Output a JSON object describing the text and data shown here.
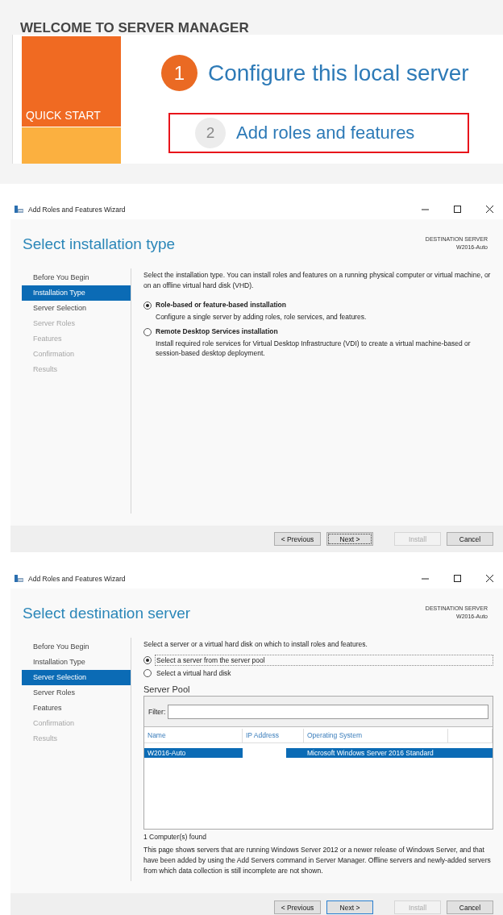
{
  "server_manager": {
    "title": "WELCOME TO SERVER MANAGER",
    "tile": {
      "label": "QUICK START"
    },
    "steps": [
      {
        "number": "1",
        "label": "Configure this local server",
        "active": true,
        "highlighted": false
      },
      {
        "number": "2",
        "label": "Add roles and features",
        "active": false,
        "highlighted": true
      }
    ]
  },
  "wizards": [
    {
      "window_title": "Add Roles and Features Wizard",
      "heading": "Select installation type",
      "destination_label": "DESTINATION SERVER",
      "destination_value": "W2016-Auto",
      "steps": [
        {
          "label": "Before You Begin",
          "selected": false,
          "disabled": false
        },
        {
          "label": "Installation Type",
          "selected": true,
          "disabled": false
        },
        {
          "label": "Server Selection",
          "selected": false,
          "disabled": false
        },
        {
          "label": "Server Roles",
          "selected": false,
          "disabled": true
        },
        {
          "label": "Features",
          "selected": false,
          "disabled": true
        },
        {
          "label": "Confirmation",
          "selected": false,
          "disabled": true
        },
        {
          "label": "Results",
          "selected": false,
          "disabled": true
        }
      ],
      "content": [
        {
          "kind": "paragraph",
          "text": "Select the installation type. You can install roles and features on a running physical computer or virtual machine, or on an offline virtual hard disk (VHD)."
        },
        {
          "kind": "option",
          "label": "Role-based or feature-based installation",
          "description": "Configure a single server by adding roles, role services, and features.",
          "selected": true,
          "focused": false
        },
        {
          "kind": "option",
          "label": "Remote Desktop Services installation",
          "description": "Install required role services for Virtual Desktop Infrastructure (VDI) to create a virtual machine-based or session-based desktop deployment.",
          "selected": false,
          "focused": false
        }
      ],
      "buttons": [
        {
          "label": "< Previous",
          "disabled": false,
          "focused": false,
          "default": false
        },
        {
          "label": "Next >",
          "disabled": false,
          "focused": true,
          "default": false
        },
        {
          "label": "Install",
          "disabled": true,
          "focused": false,
          "default": false
        },
        {
          "label": "Cancel",
          "disabled": false,
          "focused": false,
          "default": false
        }
      ]
    },
    {
      "window_title": "Add Roles and Features Wizard",
      "heading": "Select destination server",
      "destination_label": "DESTINATION SERVER",
      "destination_value": "W2016-Auto",
      "steps": [
        {
          "label": "Before You Begin",
          "selected": false,
          "disabled": false
        },
        {
          "label": "Installation Type",
          "selected": false,
          "disabled": false
        },
        {
          "label": "Server Selection",
          "selected": true,
          "disabled": false
        },
        {
          "label": "Server Roles",
          "selected": false,
          "disabled": false
        },
        {
          "label": "Features",
          "selected": false,
          "disabled": false
        },
        {
          "label": "Confirmation",
          "selected": false,
          "disabled": true
        },
        {
          "label": "Results",
          "selected": false,
          "disabled": true
        }
      ],
      "content": [
        {
          "kind": "paragraph",
          "text": "Select a server or a virtual hard disk on which to install roles and features."
        },
        {
          "kind": "radio",
          "label": "Select a server from the server pool",
          "selected": true,
          "focused": true
        },
        {
          "kind": "radio",
          "label": "Select a virtual hard disk",
          "selected": false,
          "focused": false
        },
        {
          "kind": "server_pool",
          "title": "Server Pool",
          "filter_label": "Filter:",
          "columns": [
            "Name",
            "IP Address",
            "Operating System"
          ],
          "rows": [
            {
              "name": "W2016-Auto",
              "operating_system": "Microsoft Windows Server 2016 Standard",
              "selected": true
            }
          ]
        },
        {
          "kind": "count",
          "text": "1 Computer(s) found"
        },
        {
          "kind": "paragraph",
          "text": "This page shows servers that are running Windows Server 2012 or a newer release of Windows Server, and that have been added by using the Add Servers command in Server Manager. Offline servers and newly-added servers from which data collection is still incomplete are not shown."
        }
      ],
      "buttons": [
        {
          "label": "< Previous",
          "disabled": false,
          "focused": false,
          "default": false
        },
        {
          "label": "Next >",
          "disabled": false,
          "focused": false,
          "default": true
        },
        {
          "label": "Install",
          "disabled": true,
          "focused": false,
          "default": false
        },
        {
          "label": "Cancel",
          "disabled": false,
          "focused": false,
          "default": false
        }
      ]
    }
  ]
}
